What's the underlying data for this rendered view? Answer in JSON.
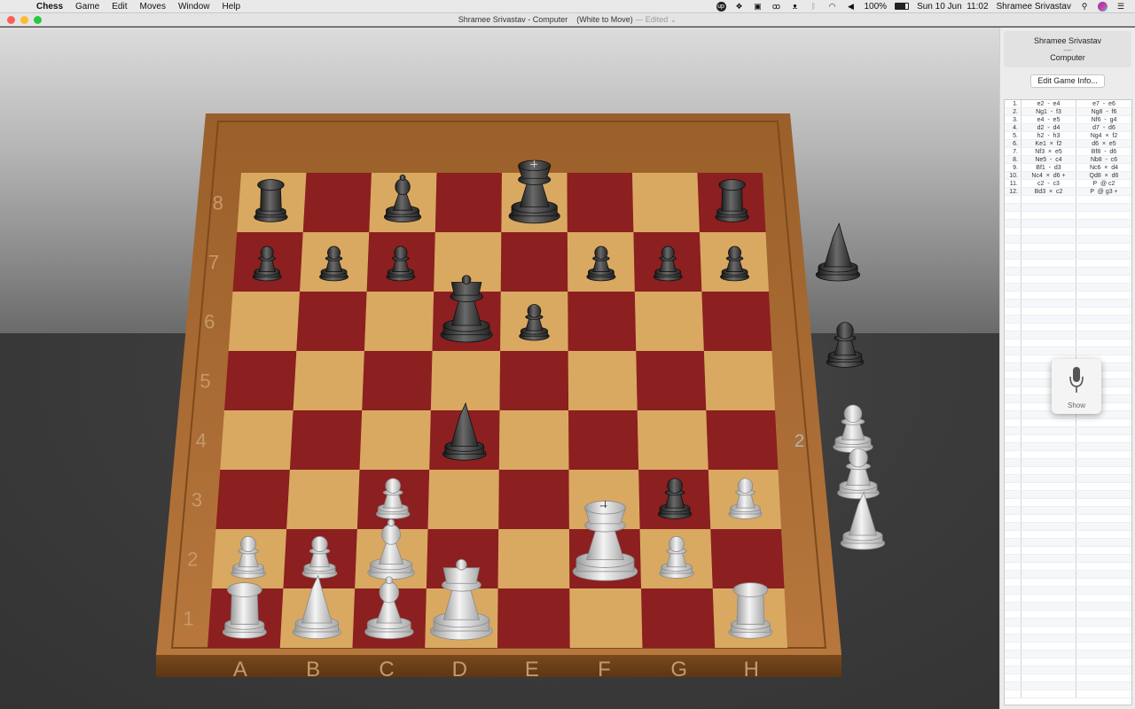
{
  "menubar": {
    "apple_icon": "apple-icon",
    "app_name": "Chess",
    "menus": [
      "Game",
      "Edit",
      "Moves",
      "Window",
      "Help"
    ],
    "battery": "100%",
    "datetime": "Sun 10 Jun  11:02",
    "user": "Shramee Srivastav",
    "status_icons": [
      "upwork-icon",
      "dropbox-icon",
      "notes-icon",
      "glasses-icon",
      "cat-icon",
      "bluetooth-icon",
      "wifi-icon",
      "volume-icon",
      "battery-icon",
      "search-icon",
      "siri-icon",
      "list-icon"
    ]
  },
  "window": {
    "title": "Shramee Srivastav - Computer    (White to Move)",
    "edited": " — Edited ⌄"
  },
  "board": {
    "files": [
      "A",
      "B",
      "C",
      "D",
      "E",
      "F",
      "G",
      "H"
    ],
    "ranks": [
      "1",
      "2",
      "3",
      "4",
      "5",
      "6",
      "7",
      "8"
    ],
    "captured_count": "2",
    "colors": {
      "light_square": "#d9a962",
      "dark_square": "#8c1f20",
      "frame": "#a0652d",
      "white_piece": "#e6e6e6",
      "black_piece": "#3a3a3a"
    }
  },
  "sidebar": {
    "player_white": "Shramee Srivastav",
    "separator": "—",
    "player_black": "Computer",
    "edit_button": "Edit Game Info..."
  },
  "moves": [
    {
      "n": "1.",
      "w": "e2  -  e4",
      "b": "e7  -  e6"
    },
    {
      "n": "2.",
      "w": "Ng1  -  f3",
      "b": "Ng8  -  f6"
    },
    {
      "n": "3.",
      "w": "e4  -  e5",
      "b": "Nf6  -  g4"
    },
    {
      "n": "4.",
      "w": "d2  -  d4",
      "b": "d7  -  d6"
    },
    {
      "n": "5.",
      "w": "h2  -  h3",
      "b": "Ng4  ×  f2"
    },
    {
      "n": "6.",
      "w": "Ke1  ×  f2",
      "b": "d6  ×  e5"
    },
    {
      "n": "7.",
      "w": "Nf3  ×  e5",
      "b": "Bf8  -  d6"
    },
    {
      "n": "8.",
      "w": "Ne5  -  c4",
      "b": "Nb8  -  c6"
    },
    {
      "n": "9.",
      "w": "Bf1  -  d3",
      "b": "Nc6  ×  d4"
    },
    {
      "n": "10.",
      "w": "Nc4  ×  d6 +",
      "b": "Qd8  ×  d6"
    },
    {
      "n": "11.",
      "w": "c2  -  c3",
      "b": "P  @ c2"
    },
    {
      "n": "12.",
      "w": "Bd3  ×  c2",
      "b": "P  @ g3 +"
    }
  ],
  "dictation": {
    "icon": "microphone-icon",
    "label": "Show"
  }
}
